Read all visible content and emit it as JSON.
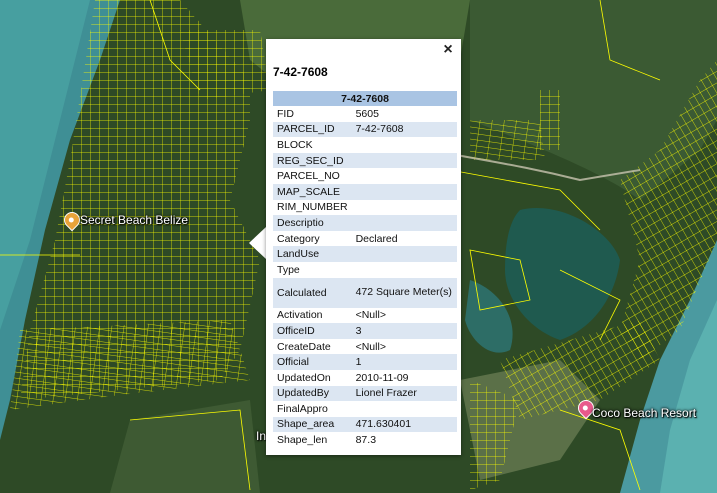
{
  "map": {
    "places": [
      {
        "name": "Secret Beach Belize",
        "pin_color": "#e7a33a",
        "icon": "food-pin-icon"
      },
      {
        "name": "Coco Beach Resort",
        "pin_color": "#e85a8c",
        "icon": "hotel-pin-icon"
      },
      {
        "name": "In"
      }
    ],
    "parcel_color": "#ffff00"
  },
  "popup": {
    "close_icon": "×",
    "title": "7-42-7608",
    "table_header": "7-42-7608",
    "fields": [
      {
        "key": "FID",
        "value": "5605"
      },
      {
        "key": "PARCEL_ID",
        "value": "7-42-7608"
      },
      {
        "key": "BLOCK",
        "value": ""
      },
      {
        "key": "REG_SEC_ID",
        "value": ""
      },
      {
        "key": "PARCEL_NO",
        "value": ""
      },
      {
        "key": "MAP_SCALE",
        "value": ""
      },
      {
        "key": "RIM_NUMBER",
        "value": ""
      },
      {
        "key": "Descriptio",
        "value": ""
      },
      {
        "key": "Category",
        "value": "Declared"
      },
      {
        "key": "LandUse",
        "value": ""
      },
      {
        "key": "Type",
        "value": ""
      },
      {
        "key": "Calculated",
        "value": "472 Square Meter(s)"
      },
      {
        "key": "Activation",
        "value": "<Null>"
      },
      {
        "key": "OfficeID",
        "value": "3"
      },
      {
        "key": "CreateDate",
        "value": "<Null>"
      },
      {
        "key": "Official",
        "value": "1"
      },
      {
        "key": "UpdatedOn",
        "value": "2010-11-09"
      },
      {
        "key": "UpdatedBy",
        "value": "Lionel Frazer"
      },
      {
        "key": "FinalAppro",
        "value": ""
      },
      {
        "key": "Shape_area",
        "value": "471.630401"
      },
      {
        "key": "Shape_len",
        "value": "87.3"
      }
    ]
  }
}
